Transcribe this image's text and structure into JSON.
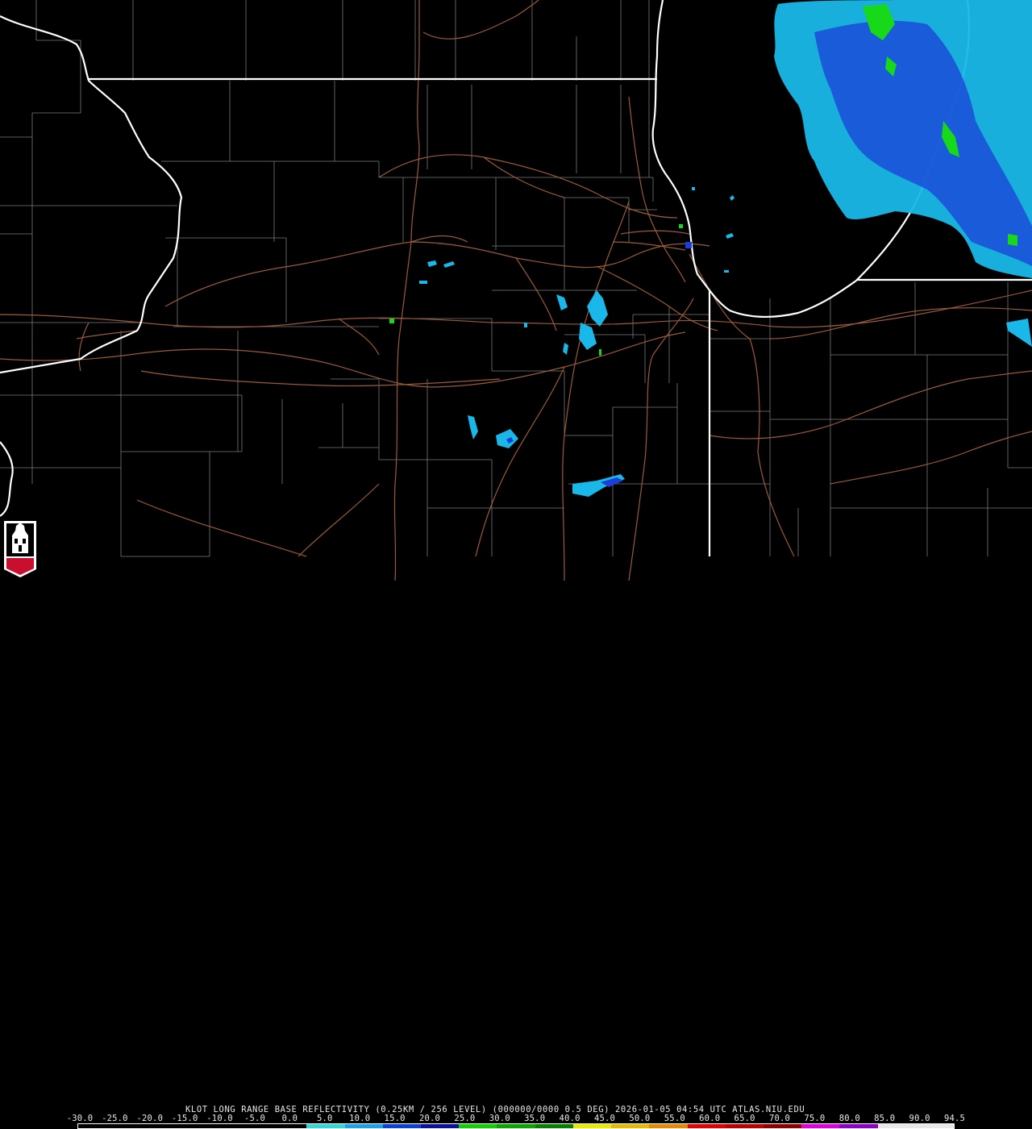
{
  "header": {
    "title": "KLOT LONG RANGE BASE REFLECTIVITY (0.25KM / 256 LEVEL) (000000/0000 0.5 DEG) 2026-01-05 04:54 UTC  ATLAS.NIU.EDU"
  },
  "logo": {
    "text": "NIU",
    "icon": "niu-tower-logo-icon"
  },
  "scale": {
    "labels": [
      "-30.0",
      "-25.0",
      "-20.0",
      "-15.0",
      "-10.0",
      "-5.0",
      "0.0",
      "5.0",
      "10.0",
      "15.0",
      "20.0",
      "25.0",
      "30.0",
      "35.0",
      "40.0",
      "45.0",
      "50.0",
      "55.0",
      "60.0",
      "65.0",
      "70.0",
      "75.0",
      "80.0",
      "85.0",
      "90.0",
      "94.5"
    ],
    "colors": [
      "#000000",
      "#000000",
      "#000000",
      "#000000",
      "#000000",
      "#000000",
      "#2fd7d7",
      "#1aa2e8",
      "#0c40d8",
      "#0a10a0",
      "#10d000",
      "#0aa600",
      "#078000",
      "#e8e800",
      "#e8b800",
      "#e88800",
      "#e80000",
      "#c00000",
      "#900000",
      "#e000e0",
      "#9000c8",
      "#e8e8e8",
      "#e8e8e8"
    ]
  }
}
